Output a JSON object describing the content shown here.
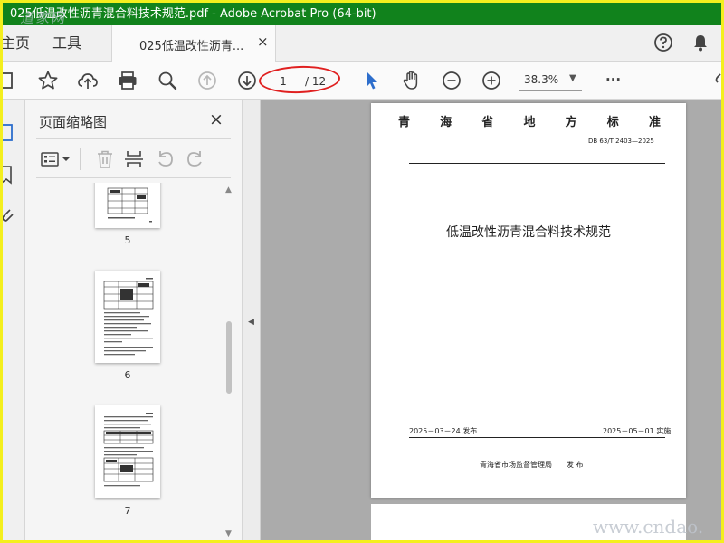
{
  "window": {
    "title": "025低温改性沥青混合料技术规范.pdf - Adobe Acrobat Pro (64-bit)"
  },
  "watermarks": {
    "top": "道家网",
    "bottom": "www.cndao."
  },
  "tabs": {
    "home": "主页",
    "tools": "工具",
    "document": "025低温改性沥青...",
    "close": "×"
  },
  "toolbar": {
    "page_current": "1",
    "page_total": "/ 12",
    "zoom": "38.3%",
    "more": "···"
  },
  "thumbnails": {
    "panel_title": "页面缩略图",
    "close": "×",
    "pages": [
      {
        "label": "5"
      },
      {
        "label": "6"
      },
      {
        "label": "7"
      }
    ]
  },
  "document": {
    "header_chars": [
      "青",
      "海",
      "省",
      "地",
      "方",
      "标",
      "准"
    ],
    "code": "DB 63/T 2403—2025",
    "title": "低温改性沥青混合料技术规范",
    "publish_date": "2025－03－24 发布",
    "implement_date": "2025－05－01 实施",
    "issuer": "青海省市场监督管理局",
    "issue_word": "发  布"
  },
  "colors": {
    "titlebar": "#11821c",
    "border": "#f4ef1e",
    "highlight": "#e02020",
    "accent": "#2d6ecc"
  }
}
